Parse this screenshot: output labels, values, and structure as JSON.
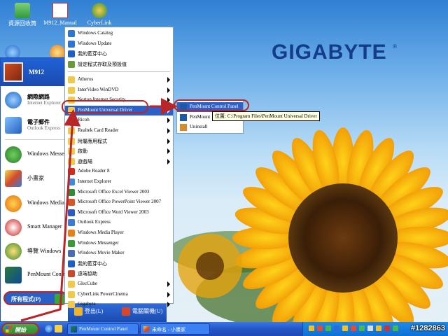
{
  "brand": {
    "name": "GIGABYTE",
    "mark": "®"
  },
  "desktop_icons": [
    {
      "label": "資源回收筒",
      "icon": "recycle-bin-icon"
    },
    {
      "label": "M912_Manual",
      "icon": "pdf-file-icon"
    },
    {
      "label": "CyberLink",
      "icon": "cyberlink-icon"
    }
  ],
  "start_menu": {
    "user": "M912",
    "pinned": [
      {
        "title": "網際網路",
        "subtitle": "Internet Explorer",
        "icon": "internet-explorer-icon"
      },
      {
        "title": "電子郵件",
        "subtitle": "Outlook Express",
        "icon": "outlook-express-icon"
      }
    ],
    "recent": [
      {
        "title": "Windows Messenger",
        "icon": "messenger-icon"
      },
      {
        "title": "小畫家",
        "icon": "paint-icon"
      },
      {
        "title": "Windows Media Player",
        "icon": "media-player-icon"
      },
      {
        "title": "Smart Manager",
        "icon": "smart-manager-icon"
      },
      {
        "title": "導覽 Windows XP",
        "icon": "tour-icon"
      },
      {
        "title": "PenMount Control Panel",
        "icon": "penmount-icon"
      }
    ],
    "all_programs": "所有程式(P)",
    "log_off": "登出(L)",
    "shut_down": "電腦關機(U)"
  },
  "programs_menu": {
    "top_items": [
      {
        "label": "Windows Catalog",
        "icon": "catalog-icon"
      },
      {
        "label": "Windows Update",
        "icon": "update-icon"
      },
      {
        "label": "我的藍芽中心",
        "icon": "bluetooth-icon"
      },
      {
        "label": "設定程式存取及預設值",
        "icon": "program-access-icon"
      }
    ],
    "items": [
      {
        "label": "Atheros",
        "icon": "folder-icon",
        "submenu": true
      },
      {
        "label": "InterVideo WinDVD",
        "icon": "folder-icon",
        "submenu": true
      },
      {
        "label": "Norton Internet Security",
        "icon": "folder-icon",
        "submenu": true
      },
      {
        "label": "PenMount Universal Driver",
        "icon": "folder-icon",
        "submenu": true,
        "selected": true
      },
      {
        "label": "Ricoh",
        "icon": "folder-icon",
        "submenu": true
      },
      {
        "label": "Realtek Card Reader",
        "icon": "folder-icon",
        "submenu": true
      },
      {
        "label": "附屬應用程式",
        "icon": "folder-icon",
        "submenu": true
      },
      {
        "label": "啟動",
        "icon": "folder-icon",
        "submenu": true
      },
      {
        "label": "遊戲場",
        "icon": "folder-icon",
        "submenu": true
      },
      {
        "label": "Adobe Reader 8",
        "icon": "adobe-reader-icon"
      },
      {
        "label": "Internet Explorer",
        "icon": "internet-explorer-icon"
      },
      {
        "label": "Microsoft Office Excel Viewer 2003",
        "icon": "excel-viewer-icon"
      },
      {
        "label": "Microsoft Office PowerPoint Viewer 2007",
        "icon": "powerpoint-viewer-icon"
      },
      {
        "label": "Microsoft Office Word Viewer 2003",
        "icon": "word-viewer-icon"
      },
      {
        "label": "Outlook Express",
        "icon": "outlook-express-icon"
      },
      {
        "label": "Windows Media Player",
        "icon": "media-player-icon"
      },
      {
        "label": "Windows Messenger",
        "icon": "messenger-icon"
      },
      {
        "label": "Windows Movie Maker",
        "icon": "movie-maker-icon"
      },
      {
        "label": "我的藍芽中心",
        "icon": "bluetooth-icon"
      },
      {
        "label": "遠端協助",
        "icon": "remote-assistance-icon"
      },
      {
        "label": "GlecCube",
        "icon": "folder-icon",
        "submenu": true
      },
      {
        "label": "CyberLink PowerCinema",
        "icon": "folder-icon",
        "submenu": true
      },
      {
        "label": "Gigabyte",
        "icon": "folder-icon",
        "submenu": true
      }
    ]
  },
  "penmount_menu": {
    "items": [
      {
        "label": "PenMount Control Panel",
        "icon": "penmount-icon",
        "selected": true
      },
      {
        "label": "PenMount",
        "icon": "penmount-icon"
      },
      {
        "label": "Uninstall",
        "icon": "uninstall-icon"
      }
    ],
    "tooltip": "位置: C:\\Program Files\\PenMount Universal Driver"
  },
  "taskbar": {
    "start": "開始",
    "buttons": [
      {
        "label": "PenMount Control Panel",
        "icon": "penmount-icon"
      },
      {
        "label": "未命名 - 小畫家",
        "icon": "paint-icon"
      }
    ]
  },
  "watermark": "#1282863"
}
